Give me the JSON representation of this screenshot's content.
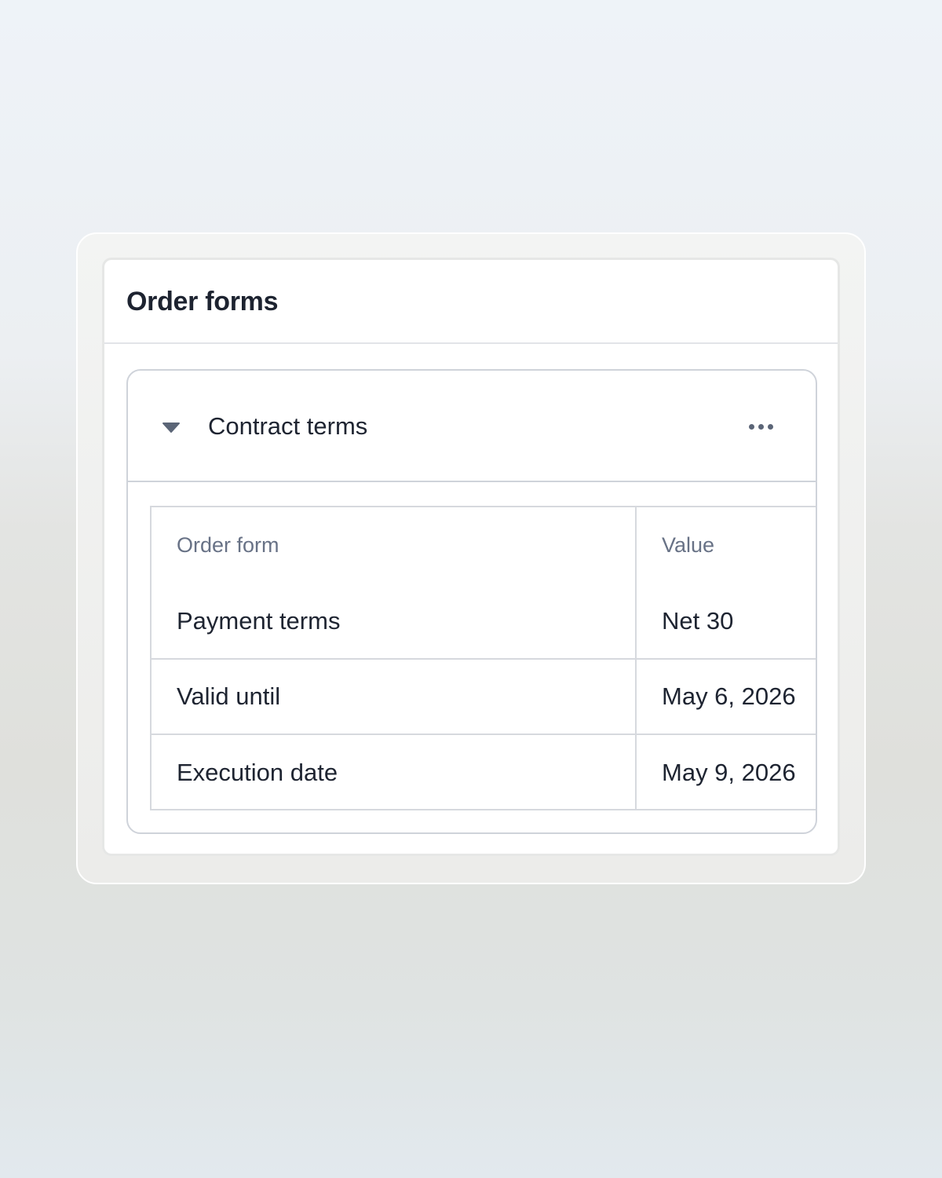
{
  "panel": {
    "title": "Order forms"
  },
  "section": {
    "title": "Contract terms",
    "caret_icon": "caret-down-icon",
    "more_icon": "more-horizontal-icon"
  },
  "table": {
    "headers": [
      "Order form",
      "Value"
    ],
    "rows": [
      {
        "label": "Payment terms",
        "value": "Net 30"
      },
      {
        "label": "Valid until",
        "value": "May 6, 2026"
      },
      {
        "label": "Execution date",
        "value": "May 9, 2026"
      }
    ]
  },
  "colors": {
    "title_text": "#1d2330",
    "header_text": "#687286",
    "border": "#d6d9de",
    "icon": "#5b6577"
  }
}
